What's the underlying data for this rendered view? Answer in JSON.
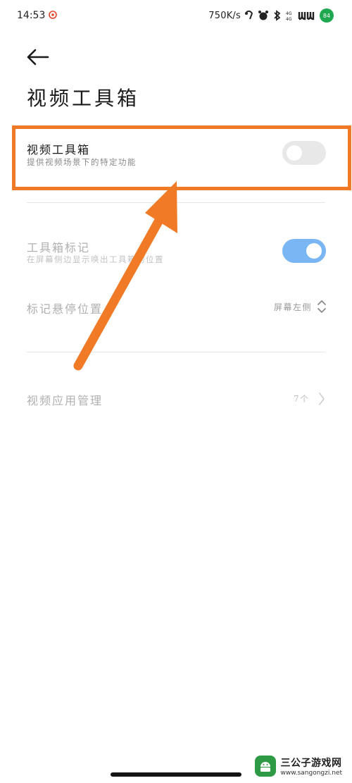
{
  "status_bar": {
    "time": "14:53",
    "network_speed": "750K/s",
    "battery_level": "84",
    "icons": [
      "app-notification-icon",
      "earphone-icon",
      "alarm-icon",
      "bluetooth-icon",
      "signal-icon",
      "wifi-icon",
      "battery-icon"
    ]
  },
  "header": {
    "title": "视频工具箱"
  },
  "settings": {
    "video_toolbox": {
      "title": "视频工具箱",
      "subtitle": "提供视频场景下的特定功能",
      "enabled": false
    },
    "toolbox_marker": {
      "title": "工具箱标记",
      "subtitle": "在屏幕侧边显示唤出工具箱的位置",
      "enabled": true
    },
    "marker_position": {
      "title": "标记悬停位置",
      "value": "屏幕左侧"
    },
    "video_app_management": {
      "title": "视频应用管理",
      "value": "7个"
    }
  },
  "watermark": {
    "title": "三公子游戏网",
    "url": "www.sangongzi.net"
  },
  "colors": {
    "highlight": "#f07a25",
    "toggle_on": "#7ab6f3",
    "toggle_off": "#e8e8e8",
    "arrow": "#f07a25",
    "battery": "#1fa84f"
  }
}
